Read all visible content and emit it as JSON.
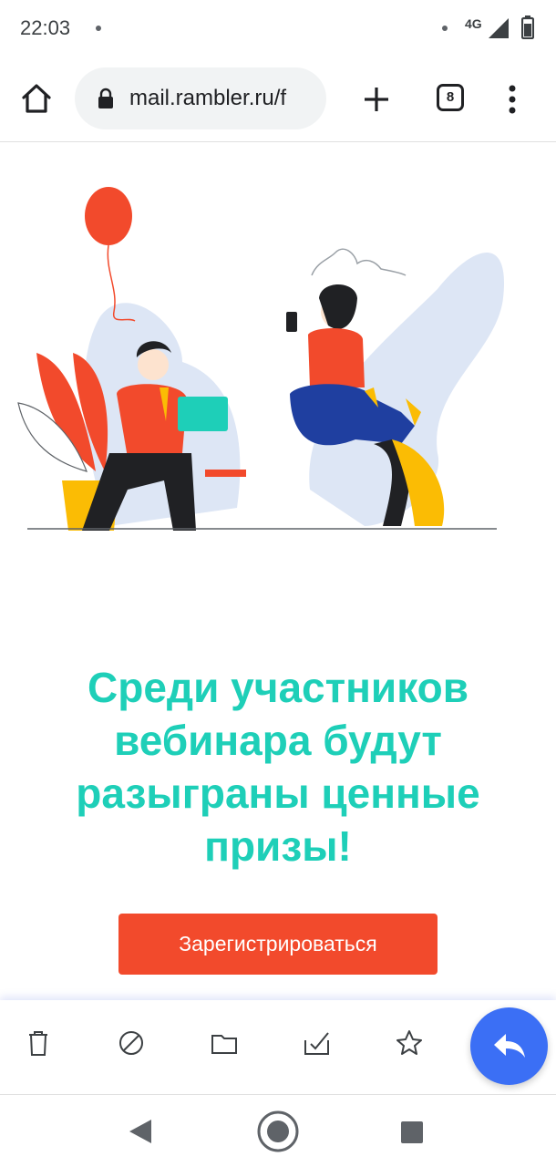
{
  "status_bar": {
    "time": "22:03",
    "network": "4G"
  },
  "browser": {
    "url": "mail.rambler.ru/f",
    "tab_count": "8",
    "icons": [
      "home-icon",
      "lock-icon",
      "new-tab-plus-icon",
      "tab-switcher-icon",
      "more-vertical-icon"
    ]
  },
  "email": {
    "headline": "Среди участников вебинара будут разыграны ценные призы!",
    "cta_label": "Зарегистрироваться",
    "colors": {
      "headline": "#1ecfb8",
      "cta": "#f24a2c"
    }
  },
  "action_bar": {
    "icons": [
      "delete-icon",
      "spam-icon",
      "folder-icon",
      "mark-read-icon",
      "star-icon",
      "reply-icon"
    ],
    "fab_color": "#3b6ff5"
  },
  "nav_bar": {
    "icons": [
      "back-icon",
      "home-circle-icon",
      "recents-icon"
    ]
  }
}
